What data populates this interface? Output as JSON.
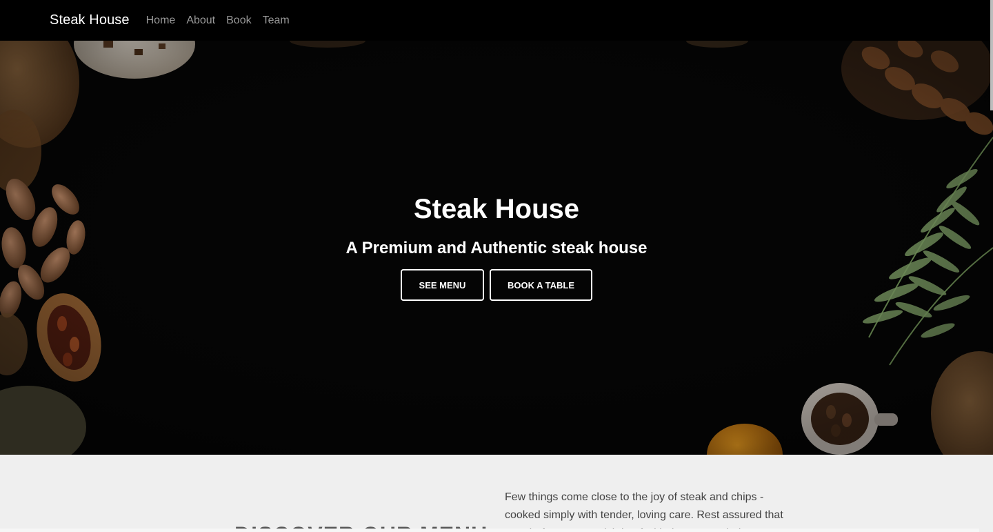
{
  "nav": {
    "brand": "Steak House",
    "links": [
      "Home",
      "About",
      "Book",
      "Team"
    ]
  },
  "hero": {
    "title": "Steak House",
    "subtitle": "A Premium and Authentic steak house",
    "buttons": {
      "see_menu": "SEE MENU",
      "book_table": "BOOK A TABLE"
    }
  },
  "discover": {
    "heading": "DISCOVER OUR MENU",
    "text": "Few things come close to the joy of steak and chips -cooked simply with tender, loving care. Rest assured that our chefs treat our Irish beef with the respect it deserves"
  },
  "colors": {
    "nav_bg": "#000000",
    "hero_bg": "#050505",
    "section_bg": "#efefef",
    "accent": "#ffffff"
  }
}
